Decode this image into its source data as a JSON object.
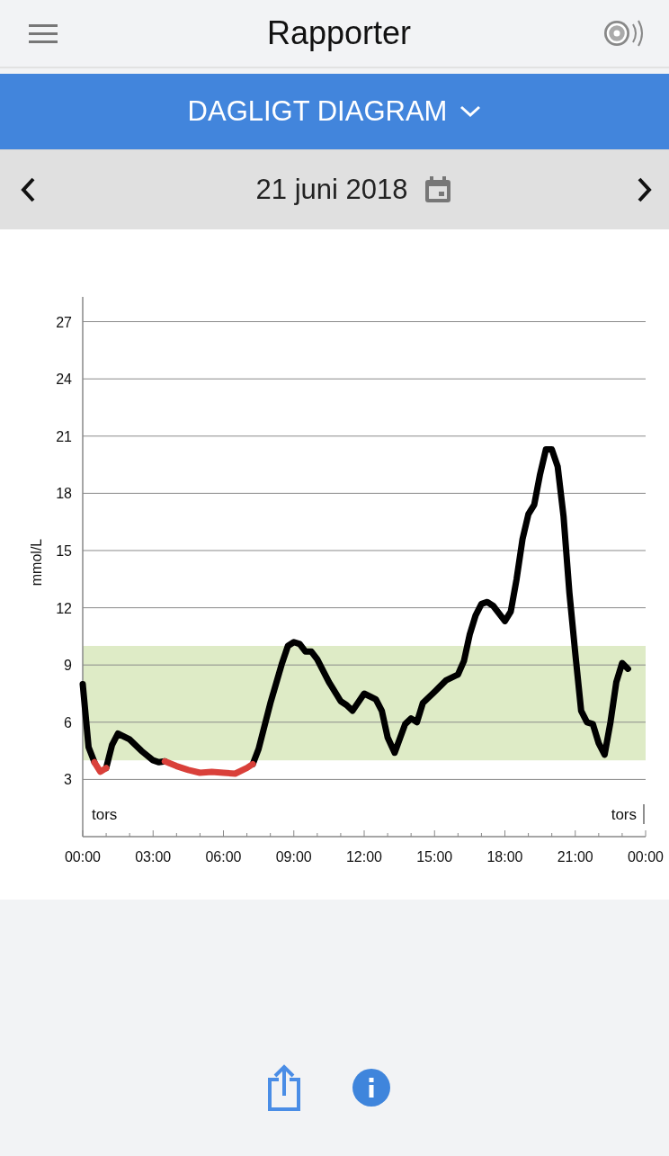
{
  "header": {
    "title": "Rapporter"
  },
  "report_selector": {
    "label": "DAGLIGT DIAGRAM"
  },
  "date_nav": {
    "date": "21 juni 2018"
  },
  "chart": {
    "chart_data": {
      "type": "line",
      "ylabel": "mmol/L",
      "xlim": [
        0,
        24
      ],
      "ylim": [
        0,
        28.3
      ],
      "xticks": [
        {
          "value": 0,
          "label": "00:00"
        },
        {
          "value": 3,
          "label": "03:00"
        },
        {
          "value": 6,
          "label": "06:00"
        },
        {
          "value": 9,
          "label": "09:00"
        },
        {
          "value": 12,
          "label": "12:00"
        },
        {
          "value": 15,
          "label": "15:00"
        },
        {
          "value": 18,
          "label": "18:00"
        },
        {
          "value": 21,
          "label": "21:00"
        },
        {
          "value": 24,
          "label": "00:00"
        }
      ],
      "yticks": [
        3,
        6,
        9,
        12,
        15,
        18,
        21,
        24,
        27
      ],
      "x": [
        0,
        0.25,
        0.5,
        0.75,
        1,
        1.25,
        1.5,
        2,
        2.5,
        3,
        3.25,
        3.5,
        4,
        4.5,
        5,
        5.5,
        6,
        6.5,
        7,
        7.25,
        7.5,
        8,
        8.5,
        8.75,
        9,
        9.25,
        9.5,
        9.75,
        10,
        10.5,
        11,
        11.25,
        11.5,
        12,
        12.5,
        12.75,
        13,
        13.3,
        13.75,
        14,
        14.25,
        14.5,
        15,
        15.5,
        16,
        16.25,
        16.5,
        16.75,
        17,
        17.25,
        17.5,
        18,
        18.25,
        18.5,
        18.75,
        19,
        19.25,
        19.5,
        19.75,
        20,
        20.25,
        20.5,
        20.75,
        21,
        21.25,
        21.5,
        21.75,
        22,
        22.25,
        22.5,
        22.75,
        23,
        23.25
      ],
      "series": [
        {
          "color": "#000000",
          "values": [
            8,
            4.7,
            3.9,
            null,
            3.6,
            4.8,
            5.4,
            5.1,
            4.5,
            4.0,
            3.9,
            3.95,
            null,
            null,
            null,
            null,
            null,
            null,
            null,
            3.8,
            4.6,
            7.0,
            9.1,
            10.0,
            10.2,
            10.1,
            9.7,
            9.7,
            9.3,
            8.1,
            7.1,
            6.9,
            6.6,
            7.5,
            7.2,
            6.6,
            5.2,
            4.4,
            5.9,
            6.2,
            6.0,
            7.0,
            7.6,
            8.2,
            8.5,
            9.2,
            10.6,
            11.6,
            12.2,
            12.3,
            12.1,
            11.3,
            11.8,
            13.5,
            15.6,
            16.9,
            17.4,
            19.0,
            20.3,
            20.3,
            19.4,
            16.8,
            12.8,
            9.6,
            6.6,
            6.0,
            5.9,
            4.9,
            4.3,
            6.0,
            8.1,
            9.1,
            8.8
          ]
        },
        {
          "color": "#d9403a",
          "values": [
            null,
            null,
            3.9,
            3.4,
            3.6,
            null,
            null,
            null,
            null,
            null,
            null,
            3.95,
            3.7,
            3.5,
            3.35,
            3.4,
            3.35,
            3.3,
            3.6,
            3.8,
            null,
            null,
            null,
            null,
            null,
            null,
            null,
            null,
            null,
            null,
            null,
            null,
            null,
            null,
            null,
            null,
            null,
            null,
            null,
            null,
            null,
            null,
            null,
            null,
            null,
            null,
            null,
            null,
            null,
            null,
            null,
            null,
            null,
            null,
            null,
            null,
            null,
            null,
            null,
            null,
            null,
            null,
            null,
            null,
            null,
            null,
            null,
            null,
            null,
            null,
            null,
            null,
            null
          ]
        }
      ],
      "grid": true,
      "bands": [
        {
          "axis": "y",
          "from": 4,
          "to": 10,
          "color": "#deebc6"
        }
      ]
    },
    "day_labels": [
      "tors",
      "tors"
    ]
  }
}
